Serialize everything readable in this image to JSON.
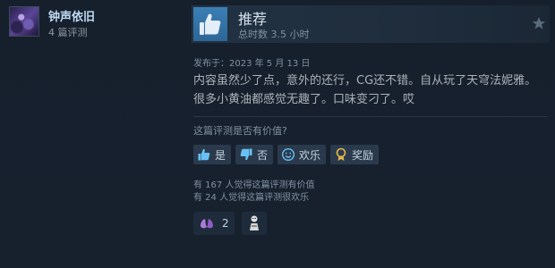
{
  "author": {
    "name": "钟声依旧",
    "review_count": "4 篇评测"
  },
  "review": {
    "verdict": "推荐",
    "hours": "总时数 3.5 小时",
    "posted": "发布于：2023 年 5 月 13 日",
    "text_line1": "内容虽然少了点，意外的还行，CG还不错。自从玩了天穹法妮雅。",
    "text_line2": "很多小黄油都感觉无趣了。口味变刁了。哎"
  },
  "feedback": {
    "question": "这篇评测是否有价值?",
    "yes_label": "是",
    "no_label": "否",
    "funny_label": "欢乐",
    "award_label": "奖励",
    "helpful_stat": "有 167 人觉得这篇评测有价值",
    "funny_stat": "有 24 人觉得这篇评测很欢乐"
  },
  "reactions": {
    "award_count": "2"
  },
  "colors": {
    "background": "#1b2838",
    "thumb_blue": "#3b7fb5",
    "award_gold": "#e8b84a",
    "reaction_purple": "#b07ad8"
  },
  "icons": {
    "thumb": "thumbs-up-icon",
    "star": "star-icon",
    "funny": "smiley-icon",
    "award": "award-icon"
  }
}
